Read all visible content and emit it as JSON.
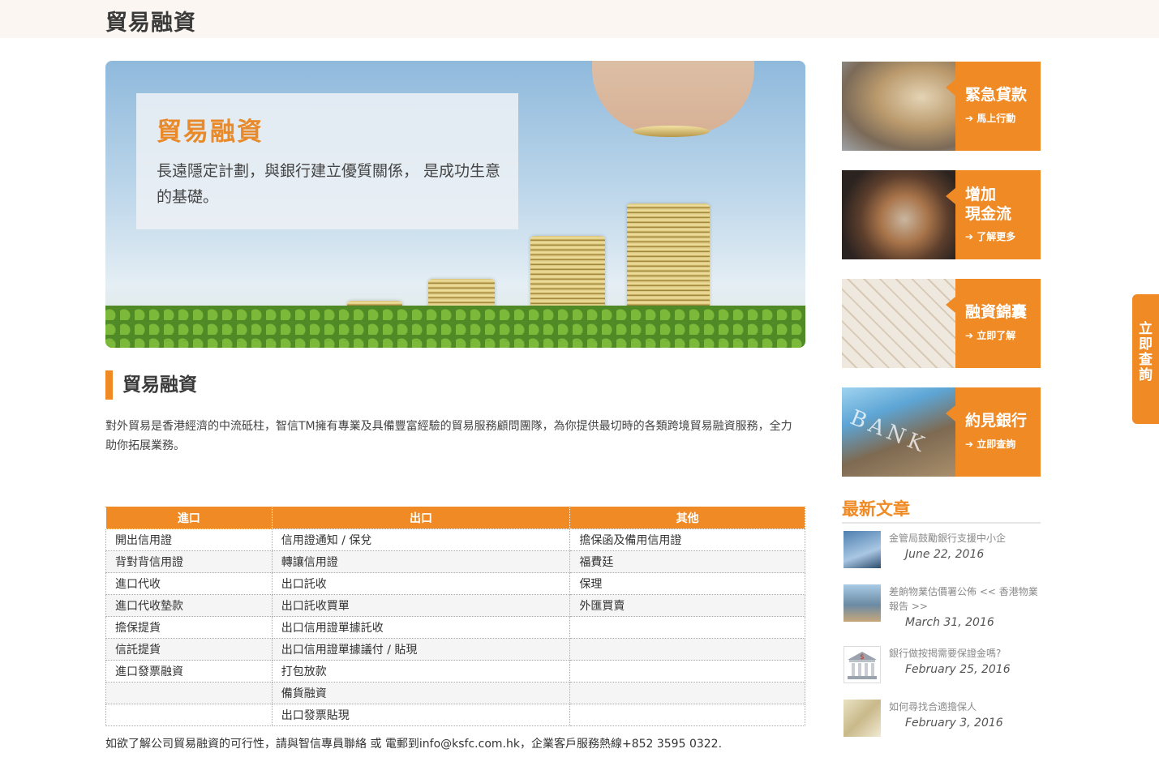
{
  "header": {
    "title": "貿易融資"
  },
  "hero": {
    "title": "貿易融資",
    "text": "長遠隱定計劃，與銀行建立優質關係， 是成功生意的基礎。"
  },
  "section": {
    "heading": "貿易融資",
    "intro": "對外貿易是香港經濟的中流砥柱，智信TM擁有專業及具備豐富經驗的貿易服務顧問團隊，為你提供最切時的各類跨境貿易融資服務，全力助你拓展業務。"
  },
  "table": {
    "headers": [
      "進口",
      "出口",
      "其他"
    ],
    "rows": [
      [
        "開出信用證",
        "信用證通知 / 保兌",
        "擔保函及備用信用證"
      ],
      [
        "背對背信用證",
        "轉讓信用證",
        "福費廷"
      ],
      [
        "進口代收",
        "出口託收",
        "保理"
      ],
      [
        "進口代收墊款",
        "出口託收買單",
        "外匯買賣"
      ],
      [
        "擔保提貨",
        "出口信用證單據託收",
        ""
      ],
      [
        "信託提貨",
        "出口信用證單據議付 / 貼現",
        ""
      ],
      [
        "進口發票融資",
        "打包放款",
        ""
      ],
      [
        "",
        "備貨融資",
        ""
      ],
      [
        "",
        "出口發票貼現",
        ""
      ]
    ]
  },
  "footer_note": "如欲了解公司貿易融資的可行性，請與智信專員聯絡 或 電郵到info@ksfc.com.hk，企業客戶服務熱線+852 3595 0322.",
  "tiles": [
    {
      "label": "緊急貸款",
      "link": "➔ 馬上行動"
    },
    {
      "label": "增加\n現金流",
      "link": "➔ 了解更多"
    },
    {
      "label": "融資錦囊",
      "link": "➔ 立即了解"
    },
    {
      "label": "約見銀行",
      "link": "➔ 立即查詢"
    }
  ],
  "bank_image_text": "BANK",
  "news": {
    "heading": "最新文章",
    "items": [
      {
        "title": "金管局鼓勵銀行支援中小企",
        "date": "June 22, 2016"
      },
      {
        "title": "差餉物業估價署公佈 << 香港物業報告 >>",
        "date": "March 31, 2016"
      },
      {
        "title": "銀行做按揭需要保證金嗎?",
        "date": "February 25, 2016"
      },
      {
        "title": "如何尋找合適擔保人",
        "date": "February 3, 2016"
      }
    ]
  },
  "side_tab": {
    "label": "立即查詢"
  },
  "colors": {
    "accent": "#ef8a25",
    "header_bg": "#fbf6f1"
  }
}
